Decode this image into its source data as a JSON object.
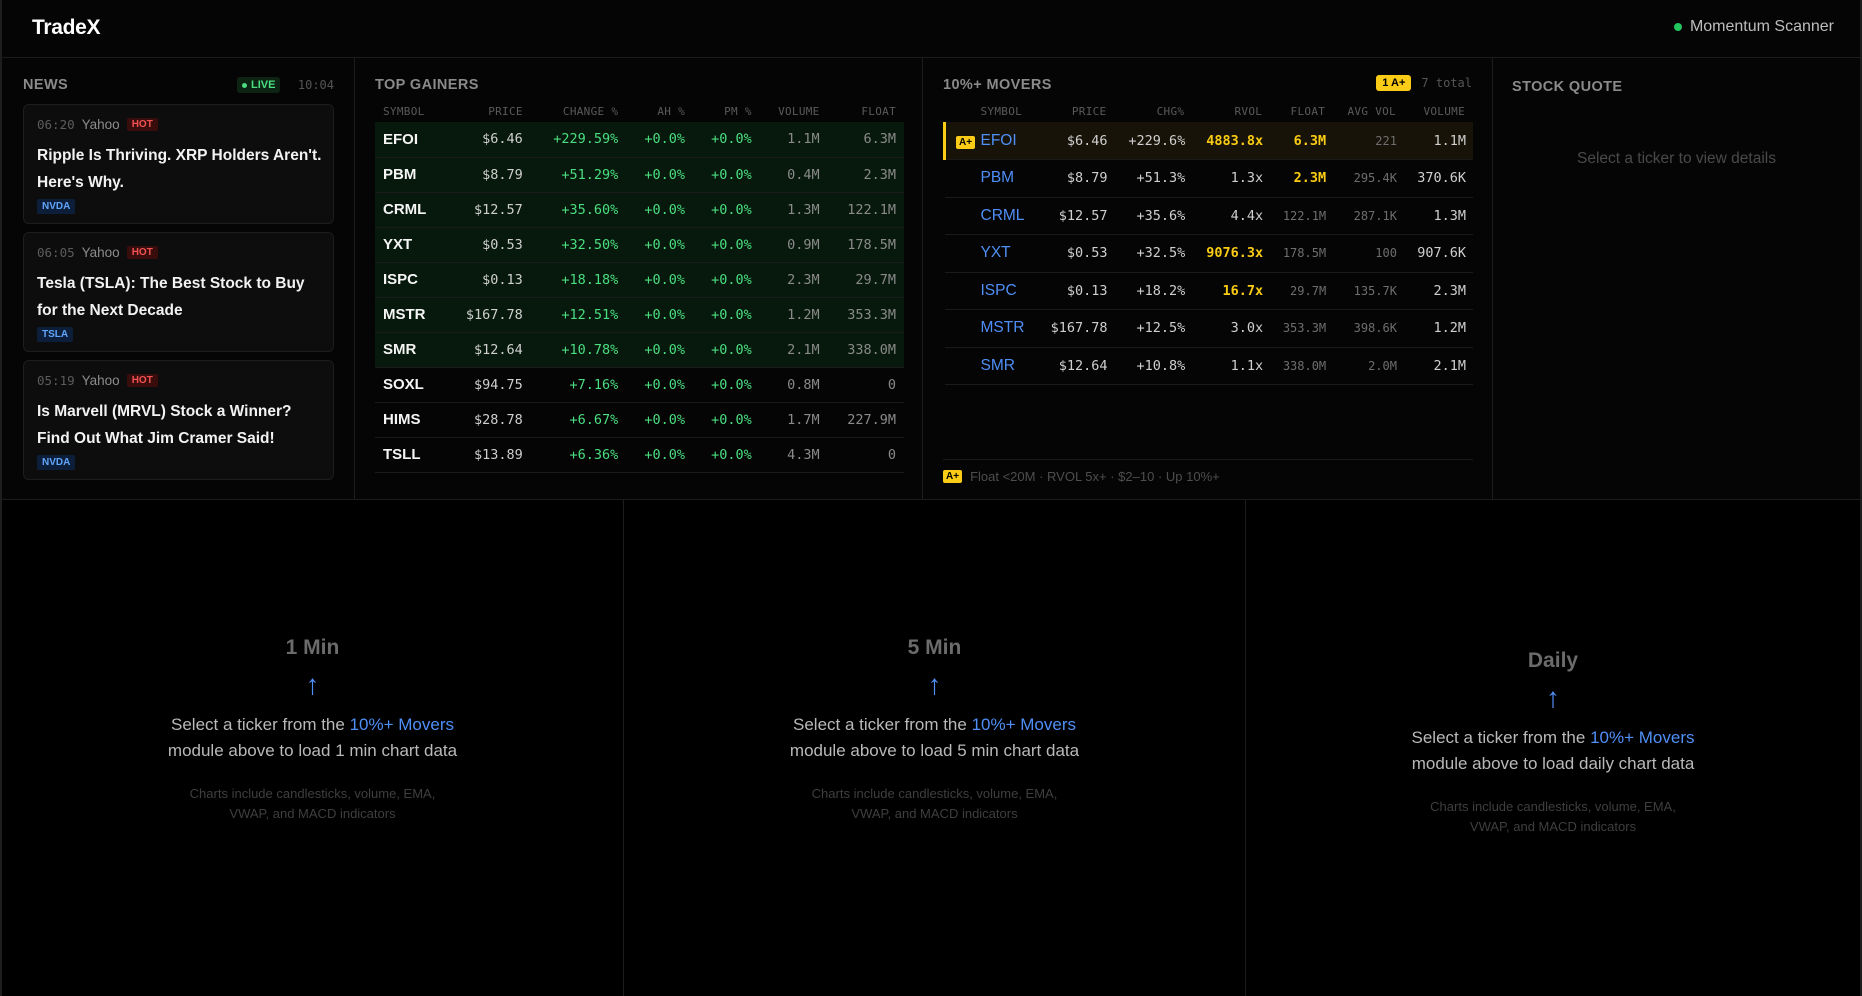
{
  "header": {
    "brand": "TradeX",
    "scanner_label": "Momentum Scanner"
  },
  "news": {
    "title": "NEWS",
    "live_label": "LIVE",
    "clock": "10:04",
    "items": [
      {
        "time": "06:20",
        "source": "Yahoo",
        "badge": "HOT",
        "headline": "Ripple Is Thriving. XRP Holders Aren't. Here's Why.",
        "ticker": "NVDA"
      },
      {
        "time": "06:05",
        "source": "Yahoo",
        "badge": "HOT",
        "headline": "Tesla (TSLA): The Best Stock to Buy for the Next Decade",
        "ticker": "TSLA"
      },
      {
        "time": "05:19",
        "source": "Yahoo",
        "badge": "HOT",
        "headline": "Is Marvell (MRVL) Stock a Winner? Find Out What Jim Cramer Said!",
        "ticker": "NVDA"
      }
    ]
  },
  "gainers": {
    "title": "TOP GAINERS",
    "columns": [
      "SYMBOL",
      "PRICE",
      "CHANGE %",
      "AH %",
      "PM %",
      "VOLUME",
      "FLOAT"
    ],
    "rows": [
      [
        "EFOI",
        "$6.46",
        "+229.59%",
        "+0.0%",
        "+0.0%",
        "1.1M",
        "6.3M"
      ],
      [
        "PBM",
        "$8.79",
        "+51.29%",
        "+0.0%",
        "+0.0%",
        "0.4M",
        "2.3M"
      ],
      [
        "CRML",
        "$12.57",
        "+35.60%",
        "+0.0%",
        "+0.0%",
        "1.3M",
        "122.1M"
      ],
      [
        "YXT",
        "$0.53",
        "+32.50%",
        "+0.0%",
        "+0.0%",
        "0.9M",
        "178.5M"
      ],
      [
        "ISPC",
        "$0.13",
        "+18.18%",
        "+0.0%",
        "+0.0%",
        "2.3M",
        "29.7M"
      ],
      [
        "MSTR",
        "$167.78",
        "+12.51%",
        "+0.0%",
        "+0.0%",
        "1.2M",
        "353.3M"
      ],
      [
        "SMR",
        "$12.64",
        "+10.78%",
        "+0.0%",
        "+0.0%",
        "2.1M",
        "338.0M"
      ],
      [
        "SOXL",
        "$94.75",
        "+7.16%",
        "+0.0%",
        "+0.0%",
        "0.8M",
        "0"
      ],
      [
        "HIMS",
        "$28.78",
        "+6.67%",
        "+0.0%",
        "+0.0%",
        "1.7M",
        "227.9M"
      ],
      [
        "TSLL",
        "$13.89",
        "+6.36%",
        "+0.0%",
        "+0.0%",
        "4.3M",
        "0"
      ]
    ]
  },
  "movers": {
    "title": "10%+ MOVERS",
    "aplus_count": "1 A+",
    "total_label": "7 total",
    "aplus_badge": "A+",
    "columns": [
      "SYMBOL",
      "PRICE",
      "CHG%",
      "RVOL",
      "FLOAT",
      "AVG VOL",
      "VOLUME"
    ],
    "rows": [
      [
        "EFOI",
        "$6.46",
        "+229.6%",
        "4883.8x",
        "6.3M",
        "221",
        "1.1M"
      ],
      [
        "PBM",
        "$8.79",
        "+51.3%",
        "1.3x",
        "2.3M",
        "295.4K",
        "370.6K"
      ],
      [
        "CRML",
        "$12.57",
        "+35.6%",
        "4.4x",
        "122.1M",
        "287.1K",
        "1.3M"
      ],
      [
        "YXT",
        "$0.53",
        "+32.5%",
        "9076.3x",
        "178.5M",
        "100",
        "907.6K"
      ],
      [
        "ISPC",
        "$0.13",
        "+18.2%",
        "16.7x",
        "29.7M",
        "135.7K",
        "2.3M"
      ],
      [
        "MSTR",
        "$167.78",
        "+12.5%",
        "3.0x",
        "353.3M",
        "398.6K",
        "1.2M"
      ],
      [
        "SMR",
        "$12.64",
        "+10.8%",
        "1.1x",
        "338.0M",
        "2.0M",
        "2.1M"
      ]
    ],
    "footer_badge": "A+",
    "footer_text": "Float <20M · RVOL 5x+ · $2–10 · Up 10%+"
  },
  "quote": {
    "title": "STOCK QUOTE",
    "empty": "Select a ticker to view details"
  },
  "charts": [
    {
      "title": "1 Min",
      "arrow": "↑",
      "msg_prefix": "Select a ticker from the ",
      "msg_link": "10%+ Movers",
      "msg_suffix": " module above to load 1 min chart data",
      "sub": "Charts include candlesticks, volume, EMA, VWAP, and MACD indicators"
    },
    {
      "title": "5 Min",
      "arrow": "↑",
      "msg_prefix": "Select a ticker from the ",
      "msg_link": "10%+ Movers",
      "msg_suffix": " module above to load 5 min chart data",
      "sub": "Charts include candlesticks, volume, EMA, VWAP, and MACD indicators"
    },
    {
      "title": "Daily",
      "arrow": "↑",
      "msg_prefix": "Select a ticker from the ",
      "msg_link": "10%+ Movers",
      "msg_suffix": " module above to load daily chart data",
      "sub": "Charts include candlesticks, volume, EMA, VWAP, and MACD indicators"
    }
  ]
}
